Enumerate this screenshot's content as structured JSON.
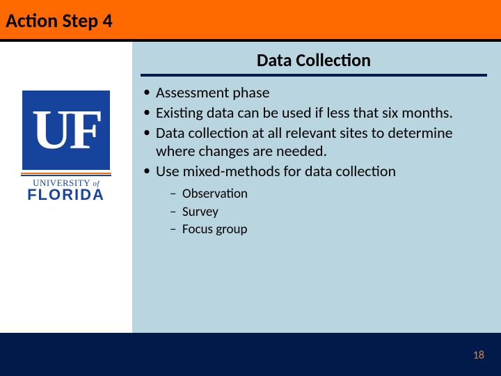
{
  "title": "Action Step 4",
  "section_title": "Data Collection",
  "bullets": [
    "Assessment phase",
    "Existing data can be used if less that six months.",
    "Data collection at all relevant sites to determine where changes are needed.",
    "Use mixed-methods for data collection"
  ],
  "sub_bullets": [
    "Observation",
    "Survey",
    "Focus group"
  ],
  "logo": {
    "letters": "UF",
    "line1_a": "UNIVERSITY ",
    "line1_b": "of",
    "line2": "FLORIDA"
  },
  "page_number": "18"
}
